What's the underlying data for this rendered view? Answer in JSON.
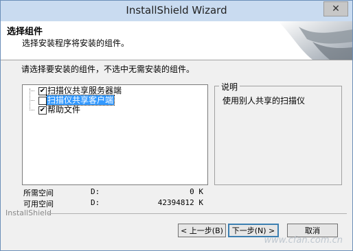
{
  "window": {
    "title": "InstallShield Wizard",
    "close_glyph": "✕"
  },
  "header": {
    "title": "选择组件",
    "subtitle": "选择安装程序将安装的组件。"
  },
  "instruction": "请选择要安装的组件，不选中无需安装的组件。",
  "components": [
    {
      "label": "扫描仪共享服务器端",
      "checked": true,
      "selected": false
    },
    {
      "label": "扫描仪共享客户端",
      "checked": false,
      "selected": true
    },
    {
      "label": "帮助文件",
      "checked": true,
      "selected": false
    }
  ],
  "description": {
    "legend": "说明",
    "text": "使用别人共享的扫描仪"
  },
  "space": {
    "required": {
      "label": "所需空间",
      "drive": "D:",
      "value": "0 K"
    },
    "available": {
      "label": "可用空间",
      "drive": "D:",
      "value": "42394812 K"
    }
  },
  "brand": "InstallShield",
  "buttons": {
    "back": "< 上一步(B)",
    "next": "下一步(N) >",
    "cancel": "取消"
  },
  "watermark": "www.cfan.com.cn"
}
